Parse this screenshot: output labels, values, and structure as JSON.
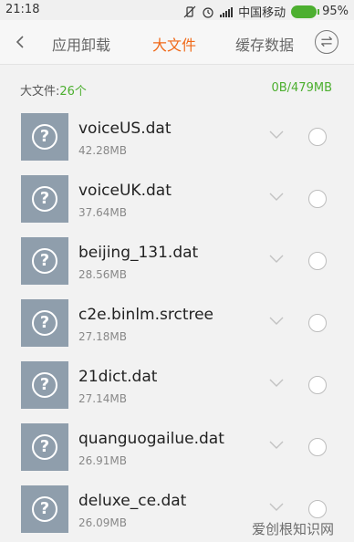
{
  "status": {
    "time": "21:18",
    "carrier": "中国移动",
    "battery": "95%"
  },
  "tabs": [
    {
      "label": "应用卸载",
      "active": false
    },
    {
      "label": "大文件",
      "active": true
    },
    {
      "label": "缓存数据",
      "active": false
    }
  ],
  "summary": {
    "label": "大文件:",
    "count": "26个",
    "size": "0B/479MB"
  },
  "files": [
    {
      "name": "voiceUS.dat",
      "size": "42.28MB"
    },
    {
      "name": "voiceUK.dat",
      "size": "37.64MB"
    },
    {
      "name": "beijing_131.dat",
      "size": "28.56MB"
    },
    {
      "name": "c2e.binlm.srctree",
      "size": "27.18MB"
    },
    {
      "name": "21dict.dat",
      "size": "27.14MB"
    },
    {
      "name": "quanguogailue.dat",
      "size": "26.91MB"
    },
    {
      "name": "deluxe_ce.dat",
      "size": "26.09MB"
    }
  ],
  "watermark": "爱创根知识网",
  "colors": {
    "accent": "#f06a1a",
    "green": "#4caf2f",
    "thumb": "#8f9eac"
  }
}
